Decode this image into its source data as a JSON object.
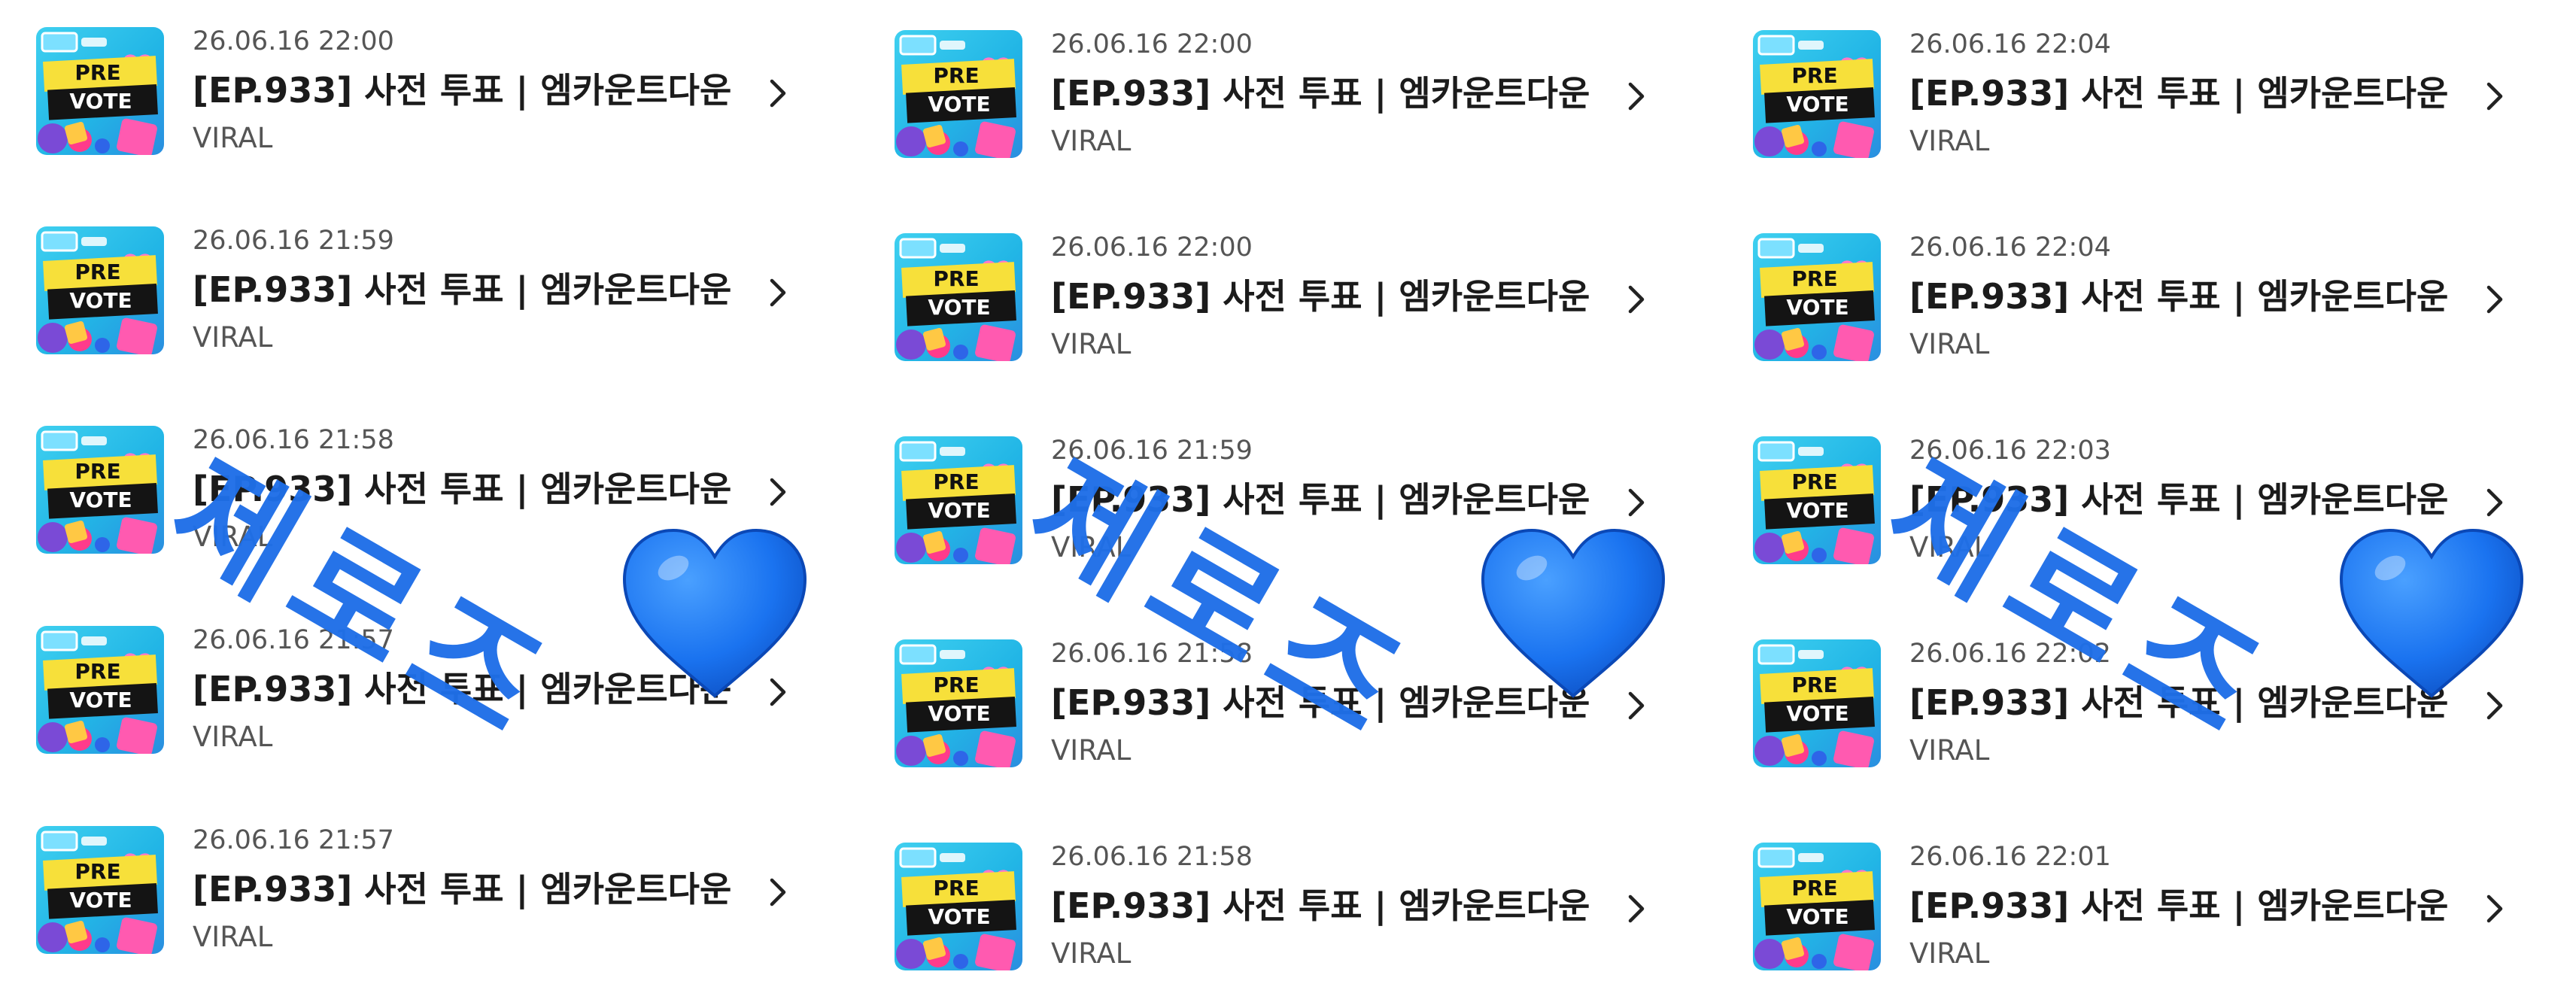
{
  "panels": [
    {
      "items": [
        {
          "timestamp": "26.06.16 22:00",
          "title": "[EP.933] 사전 투표 | 엠카운트다운",
          "channel": "VIRAL"
        },
        {
          "timestamp": "26.06.16 21:59",
          "title": "[EP.933] 사전 투표 | 엠카운트다운",
          "channel": "VIRAL"
        },
        {
          "timestamp": "26.06.16 21:58",
          "title": "[EP.933] 사전 투표 | 엠카운트다운",
          "channel": "VIRAL"
        },
        {
          "timestamp": "26.06.16 21:57",
          "title": "[EP.933] 사전 투표 | 엠카운트다운",
          "channel": "VIRAL"
        },
        {
          "timestamp": "26.06.16 21:57",
          "title": "[EP.933] 사전 투표 | 엠카운트다운",
          "channel": "VIRAL"
        }
      ],
      "sticker_text": "제로즈"
    },
    {
      "items": [
        {
          "timestamp": "26.06.16 22:00",
          "title": "[EP.933] 사전 투표 | 엠카운트다운",
          "channel": "VIRAL"
        },
        {
          "timestamp": "26.06.16 22:00",
          "title": "[EP.933] 사전 투표 | 엠카운트다운",
          "channel": "VIRAL"
        },
        {
          "timestamp": "26.06.16 21:59",
          "title": "[EP.933] 사전 투표 | 엠카운트다운",
          "channel": "VIRAL"
        },
        {
          "timestamp": "26.06.16 21:58",
          "title": "[EP.933] 사전 투표 | 엠카운트다운",
          "channel": "VIRAL"
        },
        {
          "timestamp": "26.06.16 21:58",
          "title": "[EP.933] 사전 투표 | 엠카운트다운",
          "channel": "VIRAL"
        }
      ],
      "sticker_text": "제로즈"
    },
    {
      "items": [
        {
          "timestamp": "26.06.16 22:04",
          "title": "[EP.933] 사전 투표 | 엠카운트다운",
          "channel": "VIRAL"
        },
        {
          "timestamp": "26.06.16 22:04",
          "title": "[EP.933] 사전 투표 | 엠카운트다운",
          "channel": "VIRAL"
        },
        {
          "timestamp": "26.06.16 22:03",
          "title": "[EP.933] 사전 투표 | 엠카운트다운",
          "channel": "VIRAL"
        },
        {
          "timestamp": "26.06.16 22:02",
          "title": "[EP.933] 사전 투표 | 엠카운트다운",
          "channel": "VIRAL"
        },
        {
          "timestamp": "26.06.16 22:01",
          "title": "[EP.933] 사전 투표 | 엠카운트다운",
          "channel": "VIRAL"
        }
      ],
      "sticker_text": "제로즈"
    }
  ],
  "thumbnail": {
    "line1": "PRE",
    "line2": "VOTE",
    "icon": "pre-vote-thumbnail"
  },
  "icons": {
    "chevron": "chevron-right-icon",
    "heart": "blue-heart-icon"
  },
  "colors": {
    "sticker_blue": "#1f6fe8",
    "heart_blue": "#1a73f0",
    "title_text": "#1b1b1b",
    "meta_text": "#555555"
  }
}
